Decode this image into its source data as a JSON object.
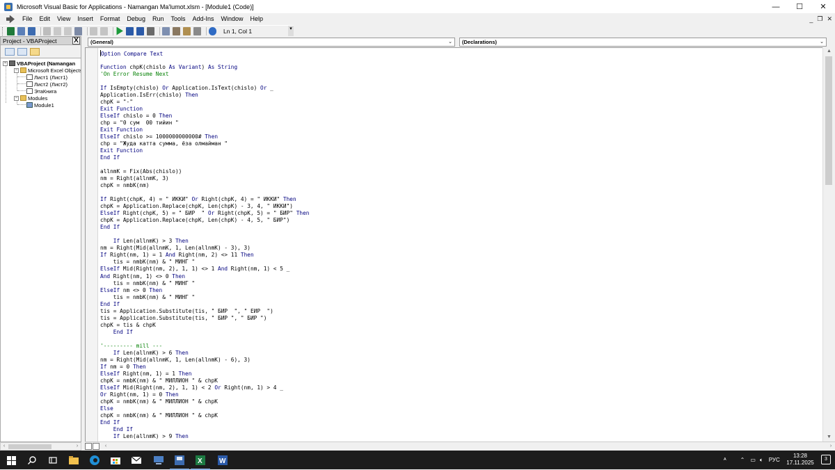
{
  "window": {
    "title": "Microsoft Visual Basic for Applications - Namangan Ma'lumot.xlsm - [Module1 (Code)]",
    "controls": {
      "minimize": "—",
      "maximize": "☐",
      "close": "✕"
    }
  },
  "menubar": {
    "items": [
      "File",
      "Edit",
      "View",
      "Insert",
      "Format",
      "Debug",
      "Run",
      "Tools",
      "Add-Ins",
      "Window",
      "Help"
    ],
    "mdi": {
      "minimize": "_",
      "restore": "❐",
      "close": "✕"
    }
  },
  "toolbar": {
    "status": "Ln 1, Col 1"
  },
  "project": {
    "title": "Project - VBAProject",
    "close": "X",
    "tree": [
      {
        "label": "VBAProject (Namangan",
        "bold": true
      },
      {
        "label": "Microsoft Excel Objects"
      },
      {
        "label": "Лист1 (Лист1)"
      },
      {
        "label": "Лист2 (Лист2)"
      },
      {
        "label": "ЭтаКнига"
      },
      {
        "label": "Modules"
      },
      {
        "label": "Module1"
      }
    ]
  },
  "combos": {
    "object": "(General)",
    "procedure": "(Declarations)"
  },
  "code": [
    {
      "t": "Option Compare Text",
      "k": "kw"
    },
    {
      "t": ""
    },
    {
      "t": "Function chpK(chislo As Variant) As String",
      "k": "kw"
    },
    {
      "t": "'On Error Resume Next",
      "k": "cm"
    },
    {
      "t": ""
    },
    {
      "t": "If IsEmpty(chislo) Or Application.IsText(chislo) Or _",
      "k": "kw"
    },
    {
      "t": "Application.IsErr(chislo) Then",
      "k": "mix"
    },
    {
      "t": "chpK = \"-\""
    },
    {
      "t": "Exit Function",
      "k": "kw"
    },
    {
      "t": "ElseIf chislo = 0 Then",
      "k": "kw"
    },
    {
      "t": "chp = \"0 сум  00 тийин \""
    },
    {
      "t": "Exit Function",
      "k": "kw"
    },
    {
      "t": "ElseIf chislo >= 1000000000000# Then",
      "k": "kw"
    },
    {
      "t": "chp = \"Жуда катта сумма, ёза олмайман \""
    },
    {
      "t": "Exit Function",
      "k": "kw"
    },
    {
      "t": "End If",
      "k": "kw"
    },
    {
      "t": ""
    },
    {
      "t": "allnmK = Fix(Abs(chislo))"
    },
    {
      "t": "nm = Right(allnmK, 3)"
    },
    {
      "t": "chpK = nmbK(nm)"
    },
    {
      "t": ""
    },
    {
      "t": "If Right(chpK, 4) = \" ИККИ\" Or Right(chpK, 4) = \" ИККИ\" Then",
      "k": "kw"
    },
    {
      "t": "chpK = Application.Replace(chpK, Len(chpK) - 3, 4, \" ИККИ\")"
    },
    {
      "t": "ElseIf Right(chpK, 5) = \" БИР  \" Or Right(chpK, 5) = \" БИР\" Then",
      "k": "kw"
    },
    {
      "t": "chpK = Application.Replace(chpK, Len(chpK) - 4, 5, \" БИР\")"
    },
    {
      "t": "End If",
      "k": "kw"
    },
    {
      "t": ""
    },
    {
      "t": "    If Len(allnmK) > 3 Then",
      "k": "kw"
    },
    {
      "t": "nm = Right(Mid(allnmK, 1, Len(allnmK) - 3), 3)"
    },
    {
      "t": "If Right(nm, 1) = 1 And Right(nm, 2) <> 11 Then",
      "k": "kw"
    },
    {
      "t": "    tis = nmbK(nm) & \" МИНГ \""
    },
    {
      "t": "ElseIf Mid(Right(nm, 2), 1, 1) <> 1 And Right(nm, 1) < 5 _",
      "k": "kw"
    },
    {
      "t": "And Right(nm, 1) <> 0 Then",
      "k": "kw"
    },
    {
      "t": "    tis = nmbK(nm) & \" МИНГ \""
    },
    {
      "t": "ElseIf nm <> 0 Then",
      "k": "kw"
    },
    {
      "t": "    tis = nmbK(nm) & \" МИНГ \""
    },
    {
      "t": "End If",
      "k": "kw"
    },
    {
      "t": "tis = Application.Substitute(tis, \" БИР  \", \" ЕИР  \")"
    },
    {
      "t": "tis = Application.Substitute(tis, \" БИР \", \" БИР \")"
    },
    {
      "t": "chpK = tis & chpK"
    },
    {
      "t": "    End If",
      "k": "kw"
    },
    {
      "t": ""
    },
    {
      "t": "'--------- mill ---",
      "k": "cm"
    },
    {
      "t": "    If Len(allnmK) > 6 Then",
      "k": "kw"
    },
    {
      "t": "nm = Right(Mid(allnmK, 1, Len(allnmK) - 6), 3)"
    },
    {
      "t": "If nm = 0 Then",
      "k": "kw"
    },
    {
      "t": "ElseIf Right(nm, 1) = 1 Then",
      "k": "kw"
    },
    {
      "t": "chpK = nmbK(nm) & \" МИЛЛИОН \" & chpK"
    },
    {
      "t": "ElseIf Mid(Right(nm, 2), 1, 1) < 2 Or Right(nm, 1) > 4 _",
      "k": "kw"
    },
    {
      "t": "Or Right(nm, 1) = 0 Then",
      "k": "kw"
    },
    {
      "t": "chpK = nmbK(nm) & \" МИЛЛИОН \" & chpK"
    },
    {
      "t": "Else",
      "k": "kw"
    },
    {
      "t": "chpK = nmbK(nm) & \" МИЛЛИОН \" & chpK"
    },
    {
      "t": "End If",
      "k": "kw"
    },
    {
      "t": "    End If",
      "k": "kw"
    },
    {
      "t": "    If Len(allnmK) > 9 Then",
      "k": "kw"
    }
  ],
  "taskbar": {
    "tray_lang": "РУС",
    "time": "13:28",
    "date": "17.11.2025",
    "notifications": "3"
  },
  "colors": {
    "keyword": "#00007f",
    "comment": "#007f00",
    "taskbar": "#1c1c1c"
  }
}
